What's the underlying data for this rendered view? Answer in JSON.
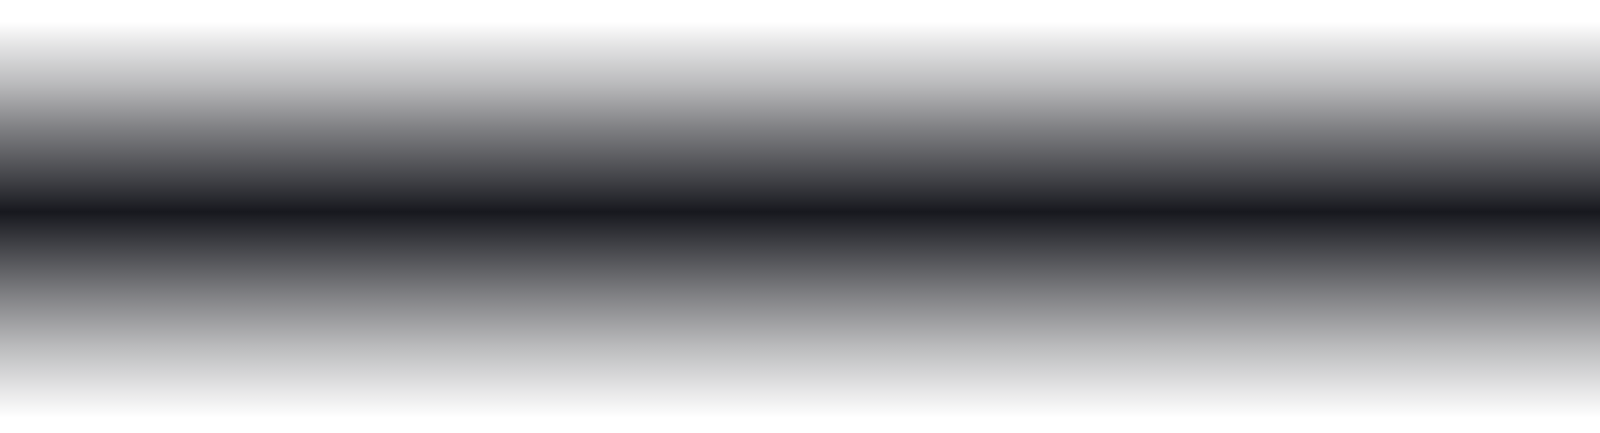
{
  "background": {
    "type": "vertical-gradient-band",
    "colors": {
      "edge": "#ffffff",
      "core": "#17181e"
    }
  }
}
